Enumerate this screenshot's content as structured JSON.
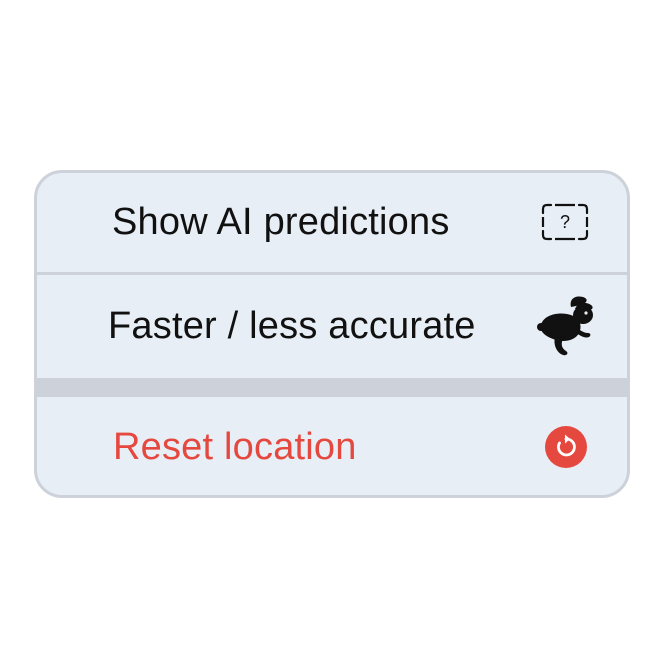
{
  "menu": {
    "items": [
      {
        "label": "Show AI predictions",
        "icon": "question-frame-icon"
      },
      {
        "label": "Faster / less accurate",
        "icon": "rabbit-icon"
      },
      {
        "label": "Reset location",
        "icon": "reset-icon"
      }
    ]
  },
  "colors": {
    "background": "#e8eef5",
    "divider": "#cdd1d9",
    "text": "#111111",
    "danger": "#e5483f"
  }
}
